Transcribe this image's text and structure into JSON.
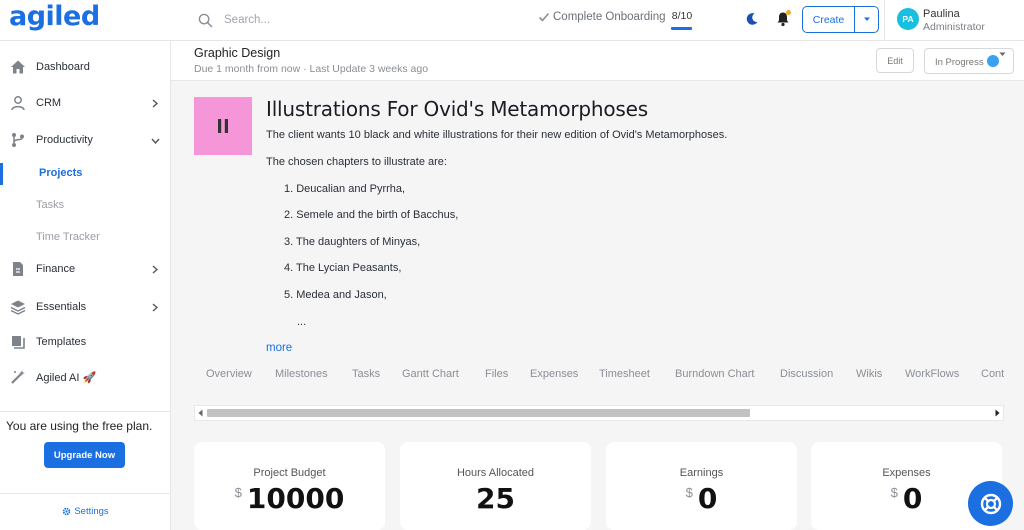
{
  "app": {
    "logo": "agiled"
  },
  "topbar": {
    "search_placeholder": "Search...",
    "onboarding_label": "Complete Onboarding",
    "onboarding_progress": "8/10",
    "create_label": "Create",
    "user": {
      "initials": "PA",
      "name": "Paulina",
      "role": "Administrator"
    }
  },
  "sidebar": {
    "items": [
      {
        "label": "Dashboard",
        "icon": "home-icon"
      },
      {
        "label": "CRM",
        "icon": "user-icon"
      },
      {
        "label": "Productivity",
        "icon": "branch-icon"
      },
      {
        "label": "Finance",
        "icon": "document-icon"
      },
      {
        "label": "Essentials",
        "icon": "layers-icon"
      },
      {
        "label": "Templates",
        "icon": "template-icon"
      },
      {
        "label": "Agiled AI 🚀",
        "icon": "magic-wand-icon"
      }
    ],
    "productivity_sub": [
      {
        "label": "Projects"
      },
      {
        "label": "Tasks"
      },
      {
        "label": "Time Tracker"
      }
    ],
    "plan_text": "You are using the free plan.",
    "upgrade_label": "Upgrade Now",
    "settings_label": "Settings"
  },
  "project": {
    "category": "Graphic Design",
    "meta": "Due 1 month from now · Last Update 3 weeks ago",
    "edit_label": "Edit",
    "status_label": "In Progress",
    "title": "Illustrations For Ovid's Metamorphoses",
    "description": "The client wants 10 black and white illustrations for their new edition of Ovid's Metamorphoses.",
    "chapters_intro": "The chosen chapters to illustrate are:",
    "chapters": [
      "1. Deucalian and Pyrrha,",
      "2. Semele and the birth of Bacchus,",
      "3. The daughters of Minyas,",
      "4. The Lycian Peasants,",
      "5. Medea and Jason,"
    ],
    "ellipsis": "...",
    "more_label": "more"
  },
  "tabs": [
    "Overview",
    "Milestones",
    "Tasks",
    "Gantt Chart",
    "Files",
    "Expenses",
    "Timesheet",
    "Burndown Chart",
    "Discussion",
    "Wikis",
    "WorkFlows",
    "Cont"
  ],
  "stats": [
    {
      "label": "Project Budget",
      "currency": "$",
      "value": "10000"
    },
    {
      "label": "Hours Allocated",
      "currency": "",
      "value": "25"
    },
    {
      "label": "Earnings",
      "currency": "$",
      "value": "0"
    },
    {
      "label": "Expenses",
      "currency": "$",
      "value": "0"
    }
  ],
  "colors": {
    "accent": "#1b6fe0",
    "thumbnail": "#f596d8",
    "status": "#3aa0f0"
  }
}
